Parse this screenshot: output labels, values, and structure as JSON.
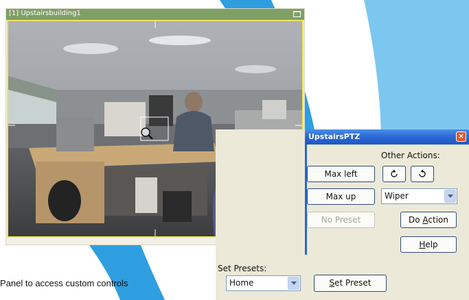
{
  "camera_window": {
    "title": "[1] Upstairsbuilding1"
  },
  "ptz_window": {
    "title": "UpstairsPTZ",
    "close_glyph": "×",
    "buttons": {
      "max_left": "Max left",
      "max_up": "Max up",
      "no_preset": "No Preset",
      "do_action": "Do Action",
      "help": "Help",
      "set_preset": "Set Preset"
    },
    "other_actions_label": "Other Actions:",
    "action_select": "Wiper",
    "set_presets_label": "Set Presets:",
    "preset_select": "Home"
  },
  "caption": "Panel to access custom controls",
  "colors": {
    "background_blue": "#7cc7ef",
    "camera_title": "#7fa064",
    "ptz_title": "#2a66d4"
  }
}
